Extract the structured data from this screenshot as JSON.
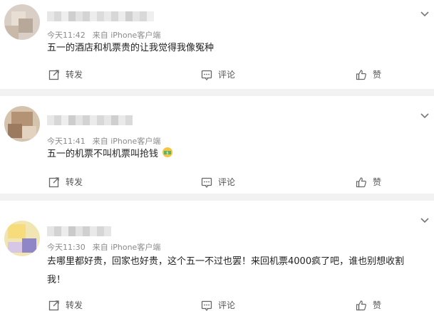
{
  "posts": [
    {
      "time": "今天11:42",
      "source": "来自 iPhone客户端",
      "content": "五一的酒店和机票贵的让我觉得我像冤种",
      "actions": {
        "repost": "转发",
        "comment": "评论",
        "like": "赞"
      }
    },
    {
      "time": "今天11:41",
      "source": "来自 iPhone客户端",
      "content": "五一的机票不叫机票叫抢钱",
      "emoji": "money-face-emoji",
      "actions": {
        "repost": "转发",
        "comment": "评论",
        "like": "赞"
      }
    },
    {
      "time": "今天11:30",
      "source": "来自 iPhone客户端",
      "content_line1": "去哪里都好贵，回家也好贵，这个五一不过也罢！来回机票4000疯了吧，谁也别想收割",
      "content_line2": "我！",
      "actions": {
        "repost": "转发",
        "comment": "评论",
        "like": "赞"
      }
    }
  ],
  "icons": {
    "repost": "repost-icon",
    "comment": "comment-icon",
    "like": "thumbs-up-icon",
    "more": "chevron-down-icon"
  }
}
